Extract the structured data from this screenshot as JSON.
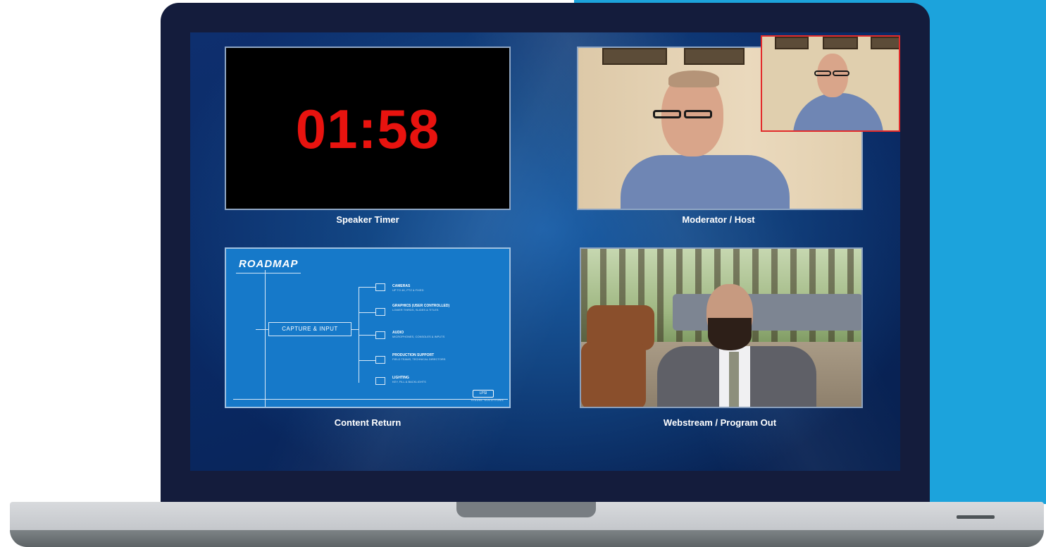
{
  "colors": {
    "accent_bg": "#1ca3dc",
    "bezel": "#141c3c",
    "timer_red": "#e8130f",
    "pip_border": "#e22b2b"
  },
  "panels": {
    "speaker_timer": {
      "time": "01:58",
      "caption": "Speaker Timer"
    },
    "moderator": {
      "caption": "Moderator / Host"
    },
    "content_return": {
      "caption": "Content Return",
      "slide": {
        "title": "ROADMAP",
        "box_label": "CAPTURE & INPUT",
        "items": [
          {
            "title": "CAMERAS",
            "sub": "UP TO 4K, PTZ & FIXED",
            "icon": "camera-icon"
          },
          {
            "title": "GRAPHICS (USER CONTROLLED)",
            "sub": "LOWER THIRDS, SLIDES & TITLES",
            "icon": "monitor-icon"
          },
          {
            "title": "AUDIO",
            "sub": "MICROPHONES, CONSOLES & INPUTS",
            "icon": "audio-icon"
          },
          {
            "title": "PRODUCTION SUPPORT",
            "sub": "FIELD TEAMS, TECHNICAL DIRECTORS",
            "icon": "laptop-icon"
          },
          {
            "title": "LIGHTING",
            "sub": "KEY, FILL & BACKLIGHTS",
            "icon": "light-icon"
          }
        ],
        "logo": "LPSI",
        "logo_text": "VISUAL SOLUTIONS"
      }
    },
    "webstream": {
      "caption": "Webstream / Program Out"
    }
  }
}
